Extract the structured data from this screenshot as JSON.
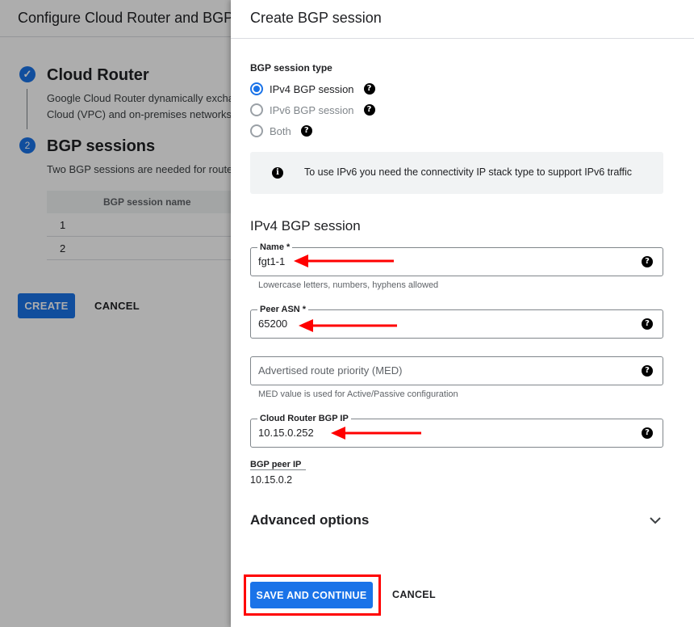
{
  "background": {
    "title": "Configure Cloud Router and BGP",
    "step1": {
      "title": "Cloud Router",
      "desc_line1": "Google Cloud Router dynamically excha",
      "desc_line2": "Cloud (VPC) and on-premises networks",
      "check_icon": "check-icon"
    },
    "step2": {
      "number": "2",
      "title": "BGP sessions",
      "desc": "Two BGP sessions are needed for route"
    },
    "table": {
      "header": "BGP session name",
      "rows": [
        "1",
        "2"
      ]
    },
    "create_label": "CREATE",
    "cancel_label": "CANCEL"
  },
  "panel": {
    "title": "Create BGP session",
    "session_type_label": "BGP session type",
    "options": [
      {
        "label": "IPv4 BGP session",
        "selected": true
      },
      {
        "label": "IPv6 BGP session",
        "selected": false
      },
      {
        "label": "Both",
        "selected": false
      }
    ],
    "info_text": "To use IPv6 you need the connectivity IP stack type to support IPv6 traffic",
    "ipv4_heading": "IPv4 BGP session",
    "name_field": {
      "label": "Name *",
      "value": "fgt1-1",
      "hint": "Lowercase letters, numbers, hyphens allowed"
    },
    "peer_asn_field": {
      "label": "Peer ASN *",
      "value": "65200"
    },
    "med_field": {
      "placeholder": "Advertised route priority (MED)",
      "hint": "MED value is used for Active/Passive configuration"
    },
    "router_ip_field": {
      "label": "Cloud Router BGP IP",
      "value": "10.15.0.252"
    },
    "peer_ip": {
      "label": "BGP peer IP",
      "value": "10.15.0.2"
    },
    "advanced_label": "Advanced options",
    "save_label": "SAVE AND CONTINUE",
    "cancel_label": "CANCEL"
  },
  "colors": {
    "accent": "#1a73e8",
    "annotation": "#ff0000"
  }
}
